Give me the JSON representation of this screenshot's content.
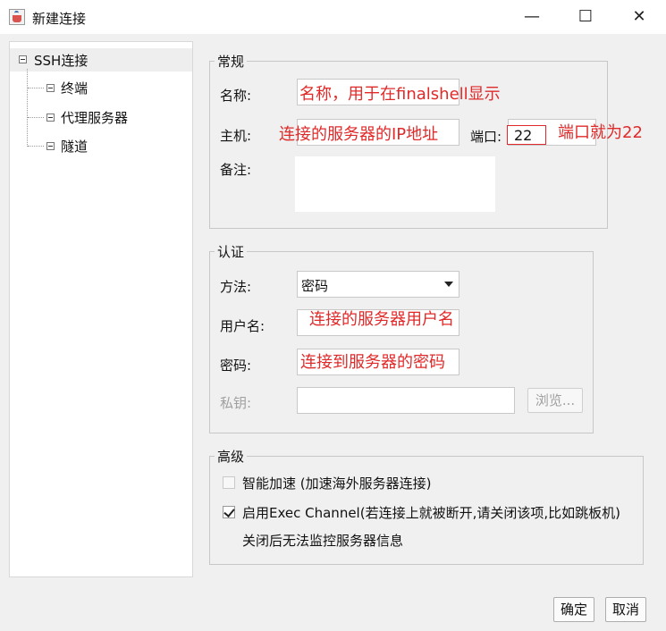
{
  "window": {
    "title": "新建连接",
    "minimize_glyph": "—",
    "maximize_glyph": "☐",
    "close_glyph": "✕"
  },
  "tree": {
    "root": "SSH连接",
    "children": [
      "终端",
      "代理服务器",
      "隧道"
    ]
  },
  "general": {
    "legend": "常规",
    "name_label": "名称:",
    "name_annotation": "名称，用于在finalshell显示",
    "host_label": "主机:",
    "host_annotation": "连接的服务器的IP地址",
    "port_label": "端口:",
    "port_value": "22",
    "port_annotation": "端口就为22",
    "note_label": "备注:"
  },
  "auth": {
    "legend": "认证",
    "method_label": "方法:",
    "method_value": "密码",
    "username_label": "用户名:",
    "username_annotation": "连接的服务器用户名",
    "password_label": "密码:",
    "password_annotation": "连接到服务器的密码",
    "private_key_label": "私钥:",
    "browse_label": "浏览..."
  },
  "advanced": {
    "legend": "高级",
    "smart_accel_label": "智能加速 (加速海外服务器连接)",
    "smart_accel_checked": false,
    "exec_channel_label": "启用Exec Channel(若连接上就被断开,请关闭该项,比如跳板机)",
    "exec_channel_checked": true,
    "exec_channel_note": "关闭后无法监控服务器信息"
  },
  "footer": {
    "ok_label": "确定",
    "cancel_label": "取消"
  },
  "colors": {
    "annotation": "#e02a2a",
    "background": "#f0f0f0"
  },
  "icons": {
    "app": "java-cup-icon",
    "tree_toggle": "minus-box-icon"
  }
}
